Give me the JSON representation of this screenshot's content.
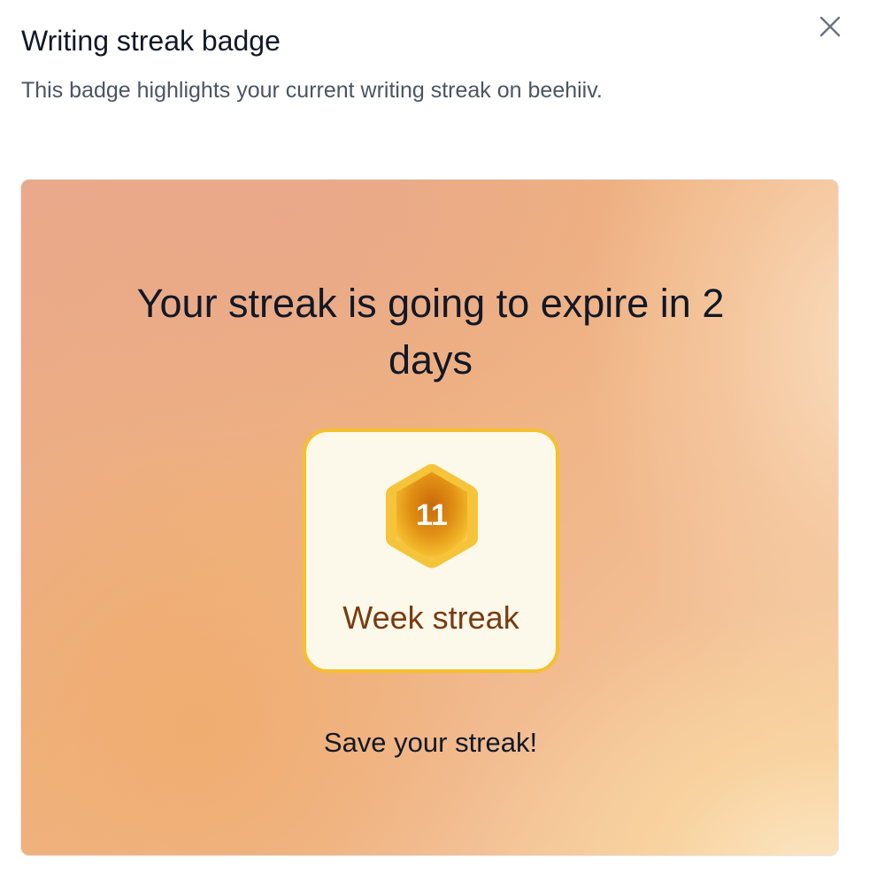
{
  "dialog": {
    "title": "Writing streak badge",
    "subtitle": "This badge highlights your current writing streak on beehiiv.",
    "close_icon": "close-icon"
  },
  "preview": {
    "headline": "Your streak is going to expire in 2 days",
    "badge": {
      "count": "11",
      "label": "Week streak",
      "icon": "hexagon-badge-icon",
      "border_color": "#f4c02e",
      "background_color": "#fdf9ea",
      "label_color": "#7a3a10"
    },
    "cta": "Save your streak!"
  }
}
